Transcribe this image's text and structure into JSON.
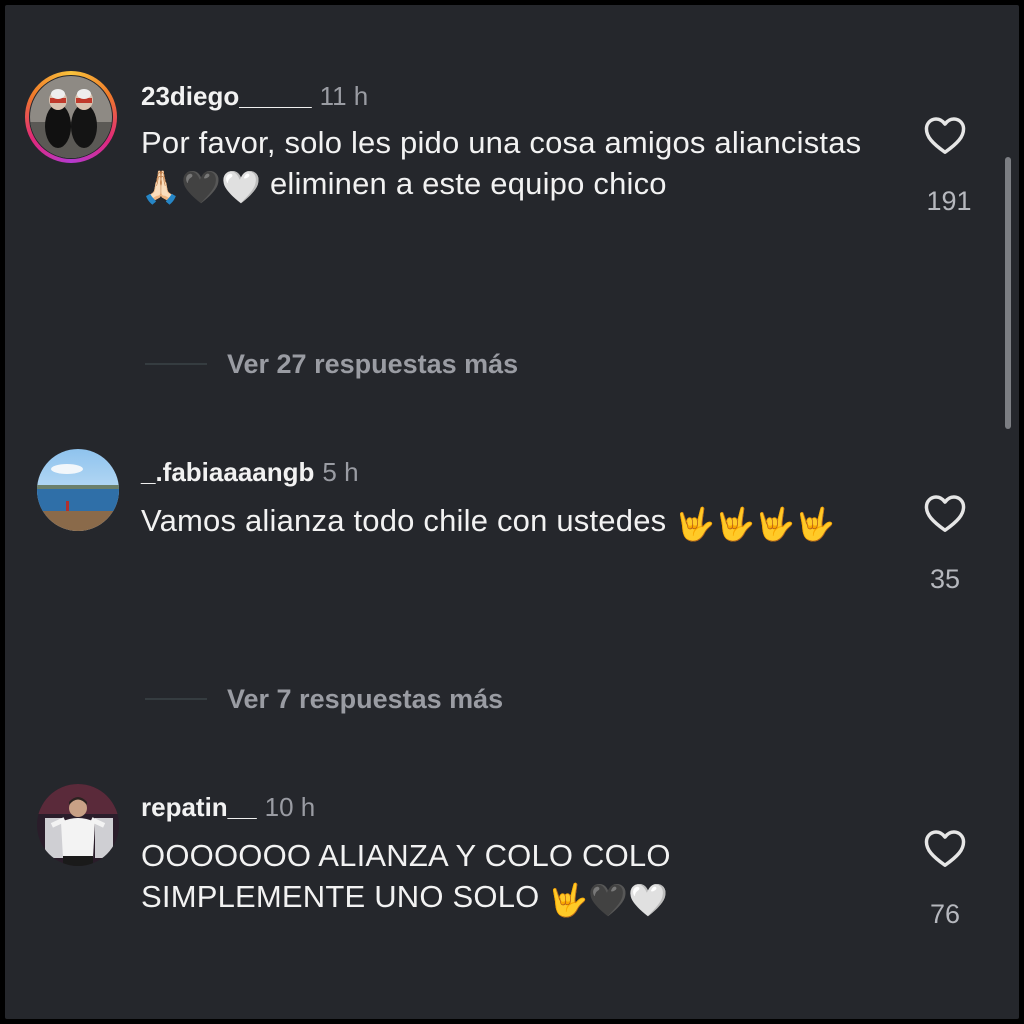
{
  "comments": [
    {
      "username": "23diego_____",
      "time": "11 h",
      "text_a": "Por favor, solo les pido una cosa amigos aliancistas ",
      "emojis_a": "🙏🏻🖤🤍",
      "text_b": " eliminen a este equipo chico",
      "emojis_b": "",
      "likes": "191",
      "has_story": true,
      "avatar": "feet-photo"
    },
    {
      "username": "_.fabiaaaangb",
      "time": "5 h",
      "text_a": "Vamos alianza todo chile con ustedes ",
      "emojis_a": "🤟🤟🤟🤟",
      "text_b": "",
      "emojis_b": "",
      "likes": "35",
      "has_story": false,
      "avatar": "lake-landscape-photo"
    },
    {
      "username": "repatin__",
      "time": "10 h",
      "text_a": "OOOOOOO ALIANZA Y COLO COLO SIMPLEMENTE UNO SOLO ",
      "emojis_a": "🤟🖤🤍",
      "text_b": "",
      "emojis_b": "",
      "likes": "76",
      "has_story": false,
      "avatar": "football-player-photo"
    }
  ],
  "reply_links": [
    {
      "label": "Ver 27 respuestas más"
    },
    {
      "label": "Ver 7 respuestas más"
    }
  ],
  "icons": {
    "like": "heart-outline-icon"
  },
  "colors": {
    "background": "#25272c",
    "text": "#f2f2f2",
    "muted": "#9a9ca3"
  }
}
